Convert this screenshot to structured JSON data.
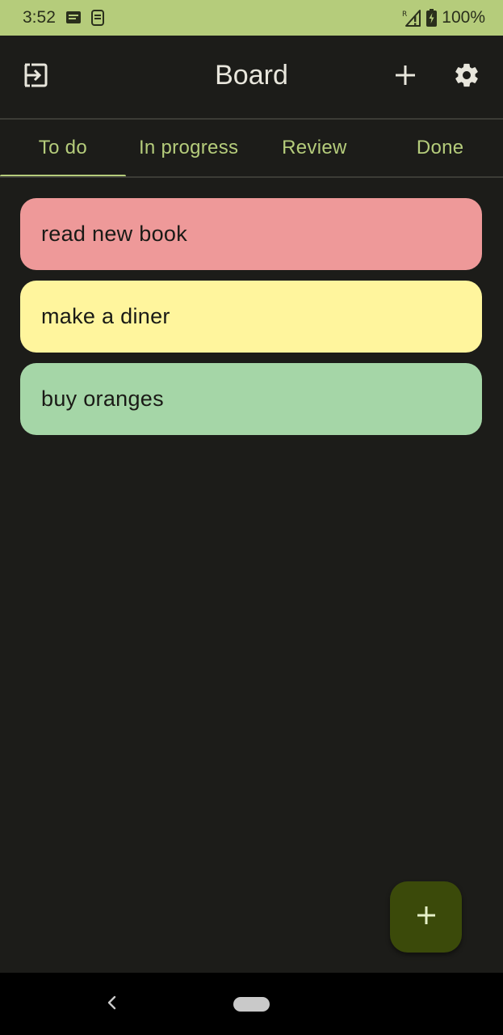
{
  "status_bar": {
    "time": "3:52",
    "battery_text": "100%",
    "icons": [
      "message-icon",
      "sim-icon",
      "signal-roaming-icon",
      "battery-charging-icon"
    ]
  },
  "app_bar": {
    "title": "Board",
    "icons": [
      "logout-icon",
      "add-icon",
      "gear-icon"
    ]
  },
  "tabs": [
    {
      "label": "To do",
      "active": true
    },
    {
      "label": "In progress",
      "active": false
    },
    {
      "label": "Review",
      "active": false
    },
    {
      "label": "Done",
      "active": false
    }
  ],
  "tasks": [
    {
      "title": "read new book",
      "color": "#ee9999"
    },
    {
      "title": "make a diner",
      "color": "#fff59d"
    },
    {
      "title": "buy oranges",
      "color": "#a5d6a7"
    }
  ],
  "fab": {
    "icon": "add-icon"
  },
  "colors": {
    "accent": "#b5cc7b",
    "background": "#1c1c19",
    "fab": "#3b4a0a"
  }
}
